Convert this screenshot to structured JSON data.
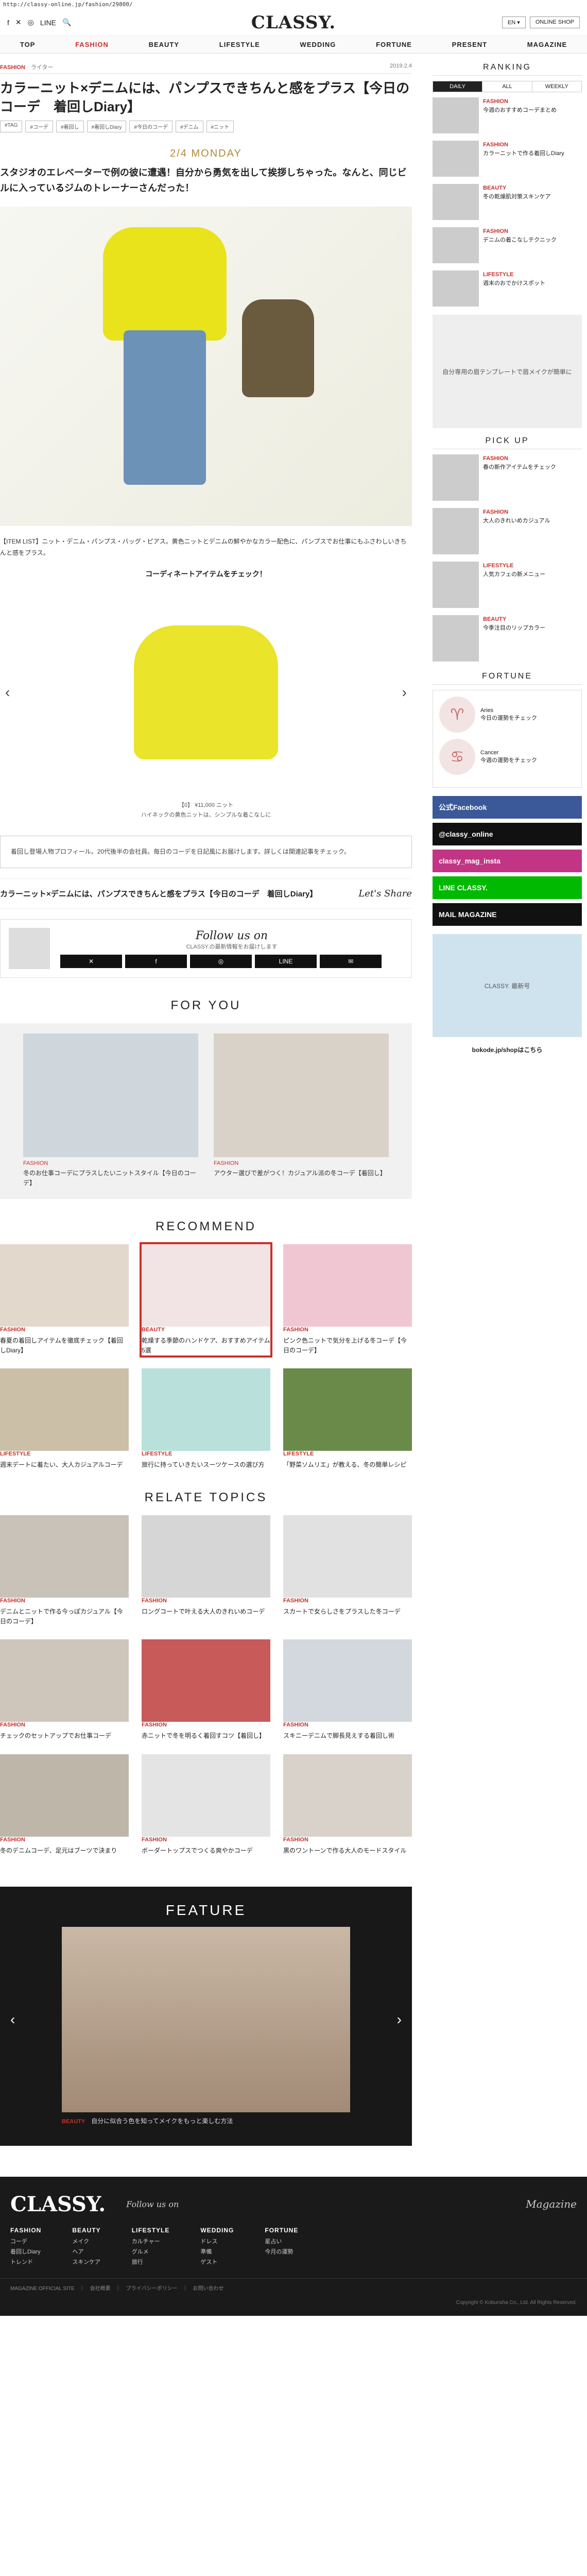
{
  "url": "http://classy-online.jp/fashion/29800/",
  "header": {
    "logo": "CLASSY.",
    "social": [
      "f",
      "✕",
      "◎",
      "LINE",
      "🔍"
    ],
    "lang_btn": "EN ▾",
    "shop_btn": "ONLINE SHOP"
  },
  "nav": [
    "TOP",
    "FASHION",
    "BEAUTY",
    "LIFESTYLE",
    "WEDDING",
    "FORTUNE",
    "PRESENT",
    "MAGAZINE"
  ],
  "article": {
    "category": "FASHION",
    "author": "ライター",
    "date": "2019.2.4",
    "title": "カラーニット×デニムには、パンプスできちんと感をプラス【今日のコーデ　着回しDiary】",
    "tags": [
      "#TAG",
      "#コーデ",
      "#着回し",
      "#着回しDiary",
      "#今日のコーデ",
      "#デニム",
      "#ニット"
    ],
    "day_label": "2/4 MONDAY",
    "lead": "スタジオのエレベーターで例の彼に遭遇！自分から勇気を出して挨拶しちゃった。なんと、同じビルに入っているジムのトレーナーさんだった！",
    "para": "【ITEM LIST】ニット・デニム・パンプス・バッグ・ピアス。黄色ニットとデニムの鮮やかなカラー配色に、パンプスでお仕事にもふさわしいきちんと感をプラス。",
    "check_title": "コーディネートアイテムをチェック！",
    "slide_caption_1": "【0】 ¥11,000 ニット",
    "slide_caption_2": "ハイネックの黄色ニットは、シンプルな着こなしに",
    "note": "着回し登場人物プロフィール。20代後半の会社員。毎日のコーデを日記風にお届けします。詳しくは関連記事をチェック。",
    "share_title": "カラーニット×デニムには、パンプスできちんと感をプラス【今日のコーデ　着回しDiary】",
    "lets_share": "Let's Share",
    "follow_title": "Follow us on",
    "follow_desc": "CLASSY.の最新情報をお届けします",
    "follow_sns": [
      "✕",
      "f",
      "◎",
      "LINE",
      "✉"
    ]
  },
  "for_you": {
    "title": "FOR YOU",
    "items": [
      {
        "cat": "FASHION",
        "desc": "冬のお仕事コーデにプラスしたいニットスタイル【今日のコーデ】"
      },
      {
        "cat": "FASHION",
        "desc": "アウター選びで差がつく！カジュアル派の冬コーデ【着回し】"
      }
    ]
  },
  "recommend": {
    "title": "RECOMMEND",
    "items": [
      {
        "cat": "FASHION",
        "desc": "春夏の着回しアイテムを徹底チェック【着回しDiary】"
      },
      {
        "cat": "BEAUTY",
        "desc": "乾燥する季節のハンドケア、おすすめアイテム5選"
      },
      {
        "cat": "FASHION",
        "desc": "ピンク色ニットで気分を上げる冬コーデ【今日のコーデ】"
      },
      {
        "cat": "LIFESTYLE",
        "desc": "週末デートに着たい、大人カジュアルコーデ"
      },
      {
        "cat": "LIFESTYLE",
        "desc": "旅行に持っていきたいスーツケースの選び方"
      },
      {
        "cat": "LIFESTYLE",
        "desc": "「野菜ソムリエ」が教える、冬の簡単レシピ"
      }
    ]
  },
  "relate": {
    "title": "RELATE TOPICS",
    "items": [
      {
        "cat": "FASHION",
        "desc": "デニムとニットで作る今っぽカジュアル【今日のコーデ】"
      },
      {
        "cat": "FASHION",
        "desc": "ロングコートで叶える大人のきれいめコーデ"
      },
      {
        "cat": "FASHION",
        "desc": "スカートで女らしさをプラスした冬コーデ"
      },
      {
        "cat": "FASHION",
        "desc": "チェックのセットアップでお仕事コーデ"
      },
      {
        "cat": "FASHION",
        "desc": "赤ニットで冬を明るく着回すコツ【着回し】"
      },
      {
        "cat": "FASHION",
        "desc": "スキニーデニムで脚長見えする着回し術"
      },
      {
        "cat": "FASHION",
        "desc": "冬のデニムコーデ、足元はブーツで決まり"
      },
      {
        "cat": "FASHION",
        "desc": "ボーダートップスでつくる爽やかコーデ"
      },
      {
        "cat": "FASHION",
        "desc": "黒のワントーンで作る大人のモードスタイル"
      }
    ]
  },
  "feature": {
    "title": "FEATURE",
    "cat": "BEAUTY",
    "caption": "自分に似合う色を知ってメイクをもっと楽しむ方法"
  },
  "sidebar": {
    "ranking_title": "RANKING",
    "ranking_tabs": [
      "DAILY",
      "ALL",
      "WEEKLY"
    ],
    "ranking": [
      {
        "cat": "FASHION",
        "desc": "今週のおすすめコーデまとめ"
      },
      {
        "cat": "FASHION",
        "desc": "カラーニットで作る着回しDiary"
      },
      {
        "cat": "BEAUTY",
        "desc": "冬の乾燥肌対策スキンケア"
      },
      {
        "cat": "FASHION",
        "desc": "デニムの着こなしテクニック"
      },
      {
        "cat": "LIFESTYLE",
        "desc": "週末のおでかけスポット"
      }
    ],
    "ad1": "自分専用の眉テンプレートで眉メイクが簡単に",
    "pickup_title": "PICK UP",
    "pickup": [
      {
        "cat": "FASHION",
        "desc": "春の新作アイテムをチェック"
      },
      {
        "cat": "FASHION",
        "desc": "大人のきれいめカジュアル"
      },
      {
        "cat": "LIFESTYLE",
        "desc": "人気カフェの新メニュー"
      },
      {
        "cat": "BEAUTY",
        "desc": "今季注目のリップカラー"
      }
    ],
    "fortune_title": "FORTUNE",
    "fortune": [
      {
        "sign": "♈",
        "name": "Aries",
        "desc": "今日の運勢をチェック"
      },
      {
        "sign": "♋",
        "name": "Cancer",
        "desc": "今週の運勢をチェック"
      }
    ],
    "banners": [
      {
        "label": "公式Facebook",
        "color": "#3b5998"
      },
      {
        "label": "@classy_online",
        "color": "#111111"
      },
      {
        "label": "classy_mag_insta",
        "color": "#c13584"
      },
      {
        "label": "LINE CLASSY.",
        "color": "#00b900"
      },
      {
        "label": "MAIL MAGAZINE",
        "color": "#111111"
      }
    ],
    "magazine_label": "CLASSY. 最新号",
    "bokode": "bokode.jp/shopはこちら"
  },
  "footer": {
    "logo": "CLASSY.",
    "follow": "Follow us on",
    "cols": [
      {
        "h": "FASHION",
        "items": [
          "コーデ",
          "着回しDiary",
          "トレンド"
        ]
      },
      {
        "h": "BEAUTY",
        "items": [
          "メイク",
          "ヘア",
          "スキンケア"
        ]
      },
      {
        "h": "LIFESTYLE",
        "items": [
          "カルチャー",
          "グルメ",
          "旅行"
        ]
      },
      {
        "h": "WEDDING",
        "items": [
          "ドレス",
          "準備",
          "ゲスト"
        ]
      },
      {
        "h": "FORTUNE",
        "items": [
          "星占い",
          "今月の運勢"
        ]
      }
    ],
    "magazine": "Magazine",
    "links": "MAGAZINE OFFICIAL SITE　｜　会社概要　｜　プライバシーポリシー　｜　お問い合わせ",
    "copyright": "Copyright © Kobunsha Co., Ltd. All Rights Reserved."
  }
}
